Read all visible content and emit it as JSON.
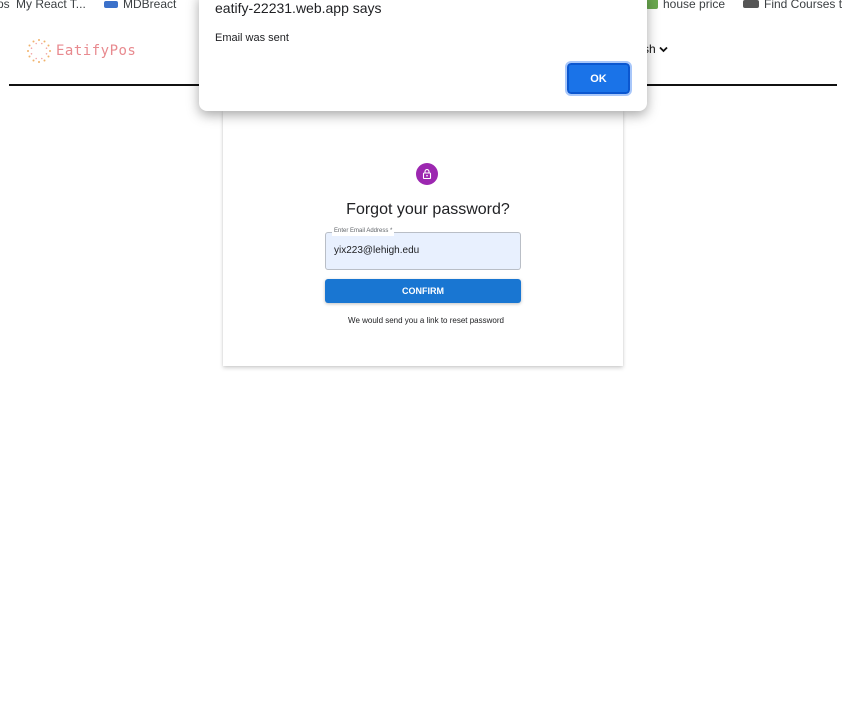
{
  "bookmarks": [
    {
      "label": "ps",
      "icon": "apps-icon"
    },
    {
      "label": "My React T...",
      "icon": "react-icon"
    },
    {
      "label": "MDBreact",
      "icon": "mdb-icon"
    },
    {
      "label": "house price",
      "icon": "chart-icon"
    },
    {
      "label": "Find Courses t",
      "icon": "ocw-icon"
    }
  ],
  "header": {
    "logo_text": "EatifyPos",
    "language_label": "sh"
  },
  "form": {
    "title": "Forgot your password?",
    "email_label": "Enter Email Address *",
    "email_value": "yix223@lehigh.edu",
    "confirm_label": "CONFIRM",
    "hint": "We would send you a link to reset password"
  },
  "dialog": {
    "title": "eatify-22231.web.app says",
    "message": "Email was sent",
    "ok_label": "OK"
  },
  "colors": {
    "primary": "#1976d2",
    "lock_avatar": "#9c27b0",
    "logo": "#e88a8f",
    "dialog_ok": "#1a73e8"
  }
}
